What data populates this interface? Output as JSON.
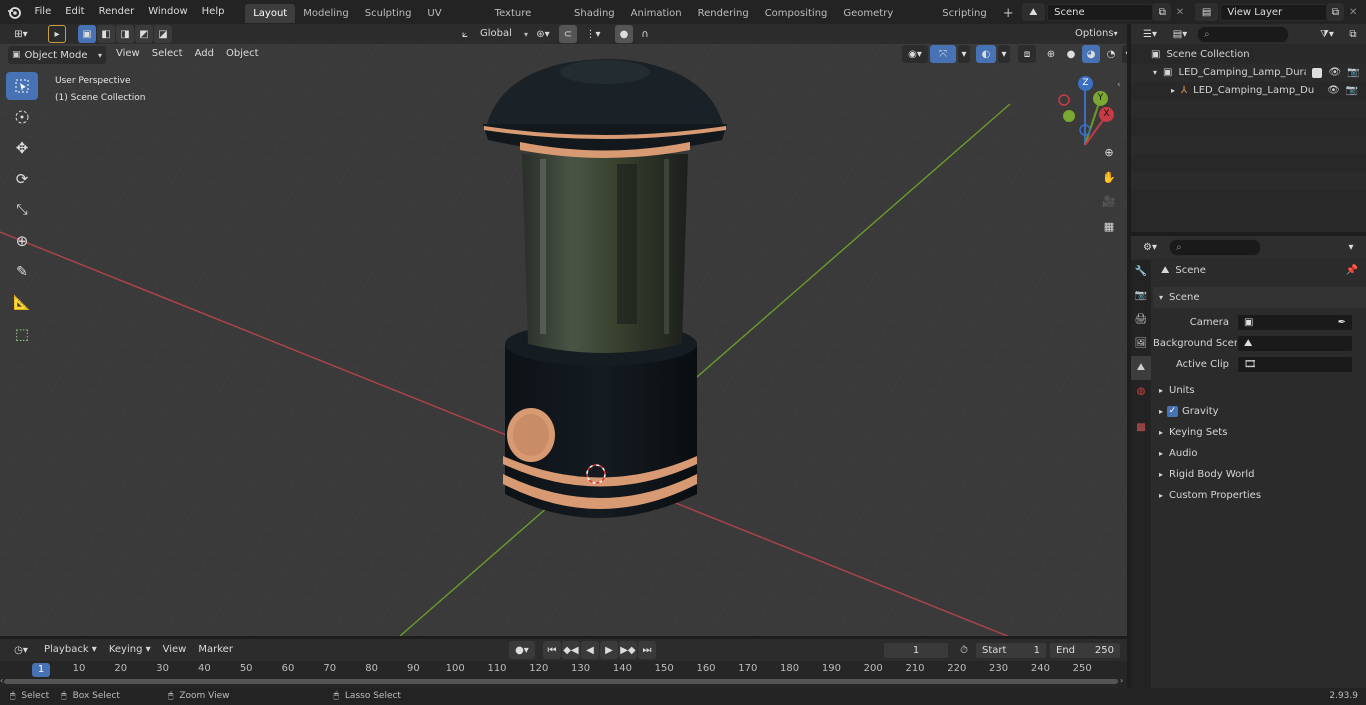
{
  "menu": [
    "File",
    "Edit",
    "Render",
    "Window",
    "Help"
  ],
  "workspaces": [
    "Layout",
    "Modeling",
    "Sculpting",
    "UV Editing",
    "Texture Paint",
    "Shading",
    "Animation",
    "Rendering",
    "Compositing",
    "Geometry Nodes",
    "Scripting"
  ],
  "active_workspace": "Layout",
  "scene_name": "Scene",
  "view_layer": "View Layer",
  "viewport": {
    "mode": "Object Mode",
    "menus": [
      "View",
      "Select",
      "Add",
      "Object"
    ],
    "transform_orientation": "Global",
    "options_label": "Options",
    "overlay_title": "User Perspective",
    "overlay_sub": "(1) Scene Collection",
    "gizmo": {
      "z": "Z",
      "y": "Y",
      "x": "X"
    }
  },
  "outliner": {
    "root": "Scene Collection",
    "items": [
      "LED_Camping_Lamp_Duracel",
      "LED_Camping_Lamp_Du"
    ]
  },
  "properties": {
    "header": "Scene",
    "section": "Scene",
    "fields": [
      {
        "label": "Camera"
      },
      {
        "label": "Background Scene"
      },
      {
        "label": "Active Clip"
      }
    ],
    "panels": [
      "Units",
      "Gravity",
      "Keying Sets",
      "Audio",
      "Rigid Body World",
      "Custom Properties"
    ]
  },
  "timeline": {
    "menus": [
      "Playback",
      "Keying",
      "View",
      "Marker"
    ],
    "current_frame": "1",
    "start_label": "Start",
    "start": "1",
    "end_label": "End",
    "end": "250",
    "ticks": [
      "1",
      "10",
      "20",
      "30",
      "40",
      "50",
      "60",
      "70",
      "80",
      "90",
      "100",
      "110",
      "120",
      "130",
      "140",
      "150",
      "160",
      "170",
      "180",
      "190",
      "200",
      "210",
      "220",
      "230",
      "240",
      "250"
    ]
  },
  "status": {
    "select": "Select",
    "box_select": "Box Select",
    "zoom_view": "Zoom View",
    "lasso_select": "Lasso Select",
    "version": "2.93.9"
  },
  "colors": {
    "accent": "#4772b3",
    "bg": "#3a3a3a",
    "lamp_trim": "#d89a72"
  }
}
